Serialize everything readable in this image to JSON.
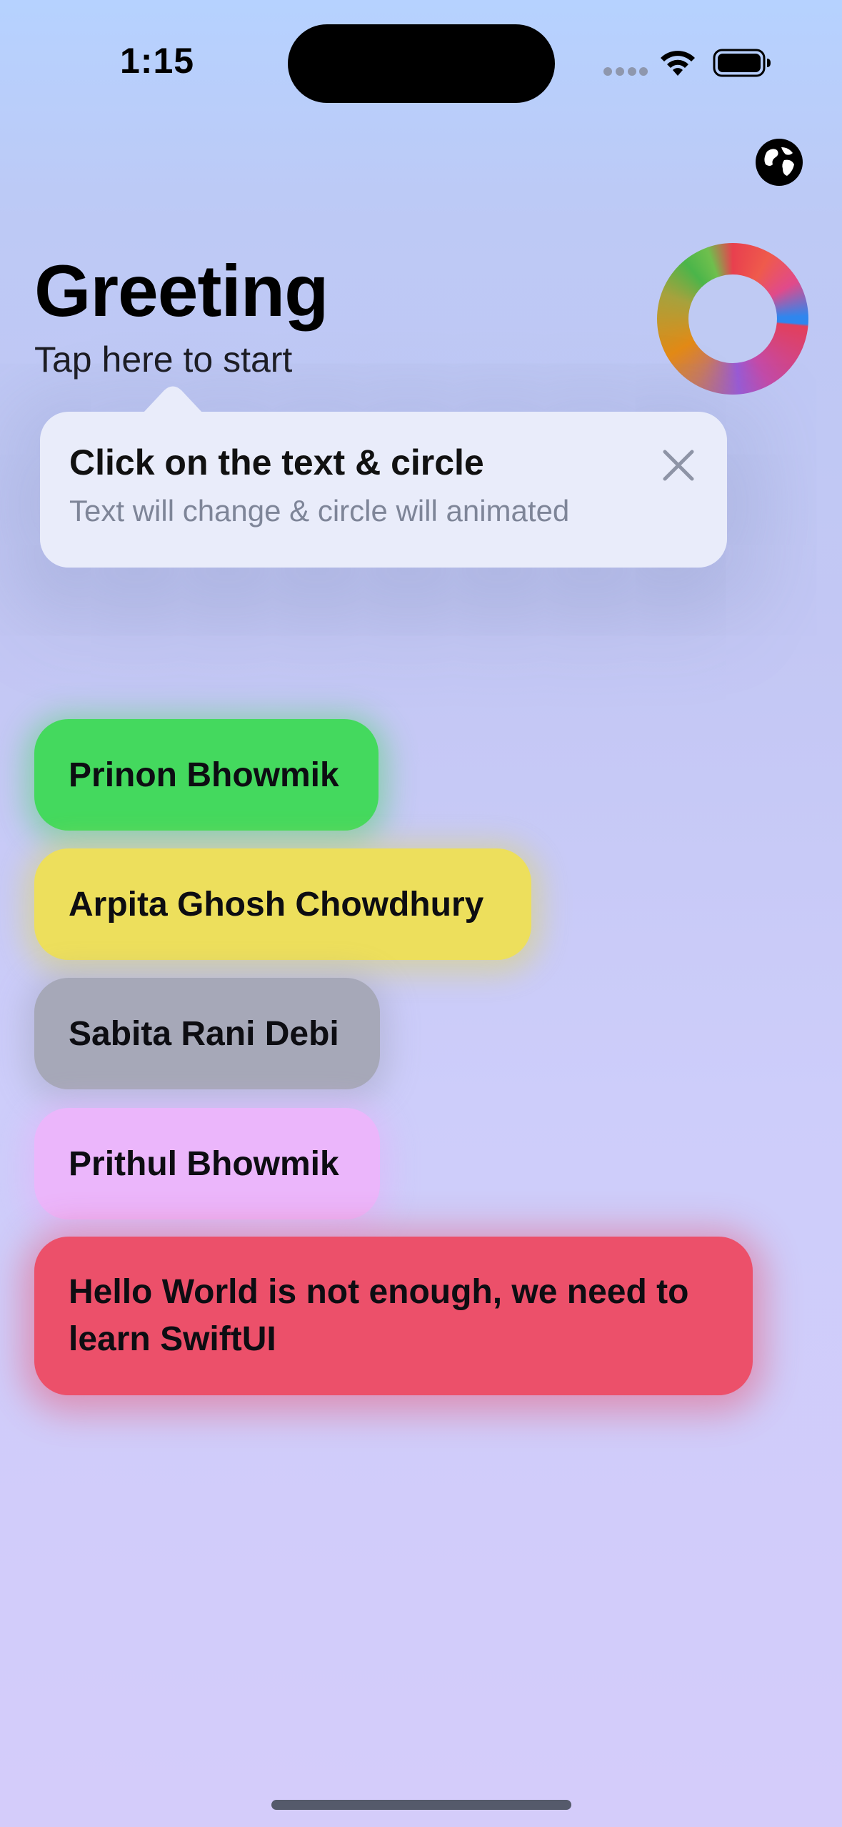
{
  "status_bar": {
    "time": "1:15"
  },
  "header": {
    "title": "Greeting",
    "subtitle": "Tap here to start",
    "globe_icon": "globe-icon"
  },
  "tooltip": {
    "title": "Click on the text & circle",
    "text": "Text will change & circle will animated",
    "close_icon": "close-icon"
  },
  "names": [
    {
      "label": "Prinon Bhowmik",
      "color": "#44d95e"
    },
    {
      "label": "Arpita Ghosh Chowdhury",
      "color": "#eddf5c"
    },
    {
      "label": "Sabita Rani Debi",
      "color": "#a6a8b8"
    },
    {
      "label": "Prithul Bhowmik",
      "color": "#ebb6fb"
    },
    {
      "label": "Hello World is not enough, we need to learn SwiftUI",
      "color": "#ec506a"
    }
  ]
}
